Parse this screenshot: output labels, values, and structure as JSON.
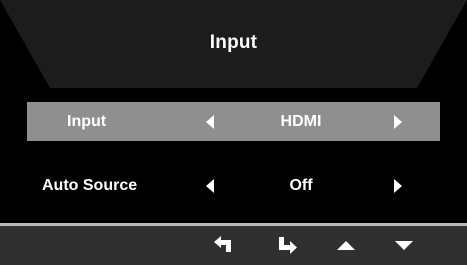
{
  "osd": {
    "title": "Input",
    "rows": [
      {
        "label": "Input",
        "value": "HDMI",
        "selected": true
      },
      {
        "label": "Auto Source",
        "value": "Off",
        "selected": false
      }
    ],
    "nav_buttons": [
      {
        "icon": "return-arrow-icon"
      },
      {
        "icon": "enter-arrow-icon"
      },
      {
        "icon": "triangle-up-icon"
      },
      {
        "icon": "triangle-down-icon"
      }
    ]
  },
  "colors": {
    "background": "#000000",
    "title_bar": "#1c1c1c",
    "selected_row": "#8f8f8f",
    "bottom_bar": "#303030",
    "divider": "#b9b9b9",
    "text": "#ffffff"
  }
}
